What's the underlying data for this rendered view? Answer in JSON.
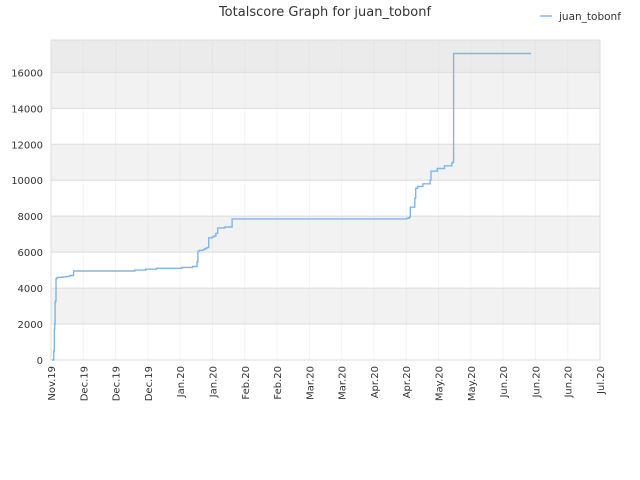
{
  "chart_data": {
    "type": "line",
    "title": "Totalscore Graph for juan_tobonf",
    "xlabel": "",
    "ylabel": "",
    "ylim": [
      0,
      17800
    ],
    "y_ticks": [
      0,
      2000,
      4000,
      6000,
      8000,
      10000,
      12000,
      14000,
      16000
    ],
    "x_ticks": [
      "Nov.19",
      "Dec.19",
      "Dec.19",
      "Dec.19",
      "Jan.20",
      "Jan.20",
      "Feb.20",
      "Feb.20",
      "Mar.20",
      "Mar.20",
      "Apr.20",
      "Apr.20",
      "May.20",
      "May.20",
      "Jun.20",
      "Jun.20",
      "Jun.20",
      "Jul.20"
    ],
    "grid": true,
    "legend_position": "top-right",
    "colors": {
      "series": "#7eb6ec",
      "band_light": "#f2f2f2",
      "band_dark": "#ebebeb",
      "grid": "#dcdcdc"
    },
    "series": [
      {
        "name": "juan_tobonf",
        "x": [
          0,
          0.9,
          1.0,
          1.3,
          1.5,
          1.7,
          2.0,
          2.2,
          2.5,
          3.0,
          4,
          6,
          8,
          10,
          12,
          14,
          16,
          18,
          20,
          22,
          24,
          26,
          28,
          30,
          32,
          34,
          36,
          37,
          38,
          40,
          42,
          44,
          45,
          46,
          47,
          48,
          49,
          50,
          52,
          54,
          56,
          57,
          58,
          60,
          62,
          64,
          66,
          68,
          70,
          72,
          74,
          76,
          78,
          80,
          80.5,
          81,
          82,
          84,
          85,
          86,
          87,
          88,
          89,
          90,
          91,
          92,
          94,
          96,
          98,
          100,
          101,
          102,
          104,
          106,
          108,
          110,
          112,
          114,
          116,
          117,
          118,
          119,
          120,
          122,
          124,
          126,
          128,
          130
        ],
        "y": [
          0,
          20,
          500,
          1700,
          2000,
          3200,
          3300,
          4500,
          4550,
          4600,
          4600,
          4620,
          4650,
          4700,
          4950,
          4950,
          4950,
          4950,
          4950,
          4950,
          4950,
          4950,
          4950,
          4950,
          4950,
          4950,
          4950,
          4950,
          4950,
          4950,
          4950,
          4950,
          4950,
          5000,
          5000,
          5000,
          5000,
          5000,
          5050,
          5050,
          5050,
          5050,
          5100,
          5100,
          5100,
          5100,
          5100,
          5100,
          5100,
          5150,
          5150,
          5150,
          5200,
          5200,
          5450,
          6050,
          6100,
          6150,
          6200,
          6250,
          6800,
          6800,
          6850,
          6900,
          7050,
          7350,
          7350,
          7400,
          7400,
          7850,
          7850,
          7850,
          7850,
          7850,
          7850,
          7850,
          7850,
          7850,
          7850,
          7850,
          7850,
          7850,
          7850,
          7850,
          7850,
          7850,
          7850,
          7850
        ]
      }
    ]
  }
}
